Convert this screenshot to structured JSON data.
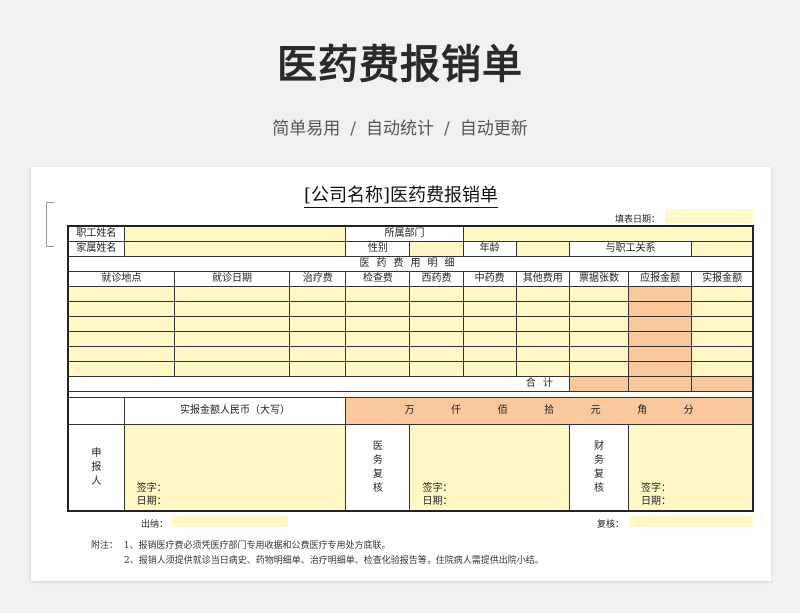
{
  "hero": {
    "title": "医药费报销单",
    "tagline": [
      "简单易用",
      "自动统计",
      "自动更新"
    ],
    "separator": "/"
  },
  "form": {
    "title": "[公司名称]医药费报销单",
    "fill_date_label": "填表日期：",
    "employee_name": "职工姓名",
    "department": "所属部门",
    "family_name": "家属姓名",
    "gender": "性别",
    "age": "年龄",
    "relation": "与职工关系",
    "section_title": "医药费用明细",
    "columns": [
      "就诊地点",
      "就诊日期",
      "治疗费",
      "检查费",
      "西药费",
      "中药费",
      "其他费用",
      "票据张数",
      "应报金额",
      "实报金额"
    ],
    "total_label": "合 计",
    "amount_in_words_label": "实报金额人民币（大写）",
    "units": [
      "万",
      "仟",
      "佰",
      "拾",
      "元",
      "角",
      "分"
    ],
    "applicant": "申报人",
    "medical_review": "医务复核",
    "finance_review": "财务复核",
    "sign_label": "签字：",
    "date_label": "日期：",
    "cashier_label": "出纳：",
    "review_label": "复核："
  },
  "notes": {
    "prefix": "附注：",
    "items": [
      "1、报销医疗费必须凭医疗部门专用收据和公费医疗专用处方底联。",
      "2、报销人须提供就诊当日病史、药物明细单、治疗明细单、检查化验报告等，住院病人需提供出院小结。"
    ]
  },
  "colors": {
    "yellow_fill": "#fff8c6",
    "orange_fill": "#f9c89c"
  }
}
